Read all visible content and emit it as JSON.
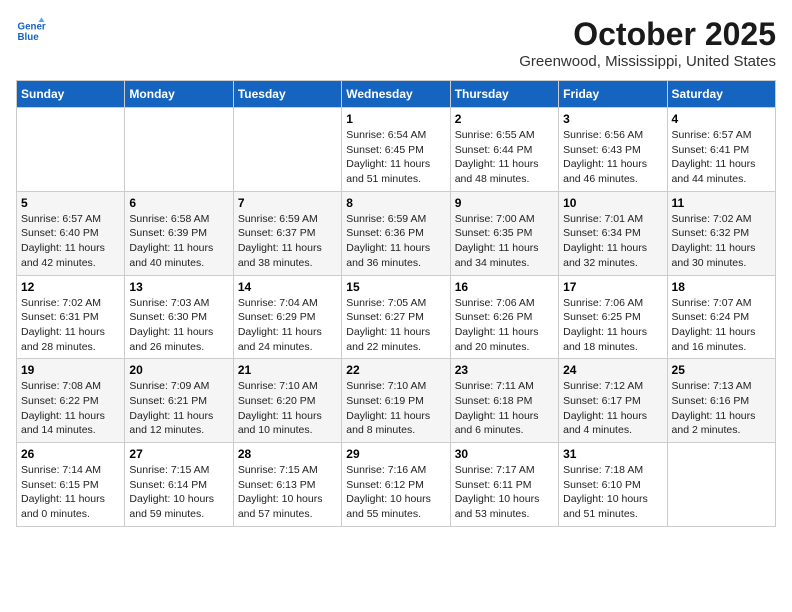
{
  "header": {
    "logo_line1": "General",
    "logo_line2": "Blue",
    "month": "October 2025",
    "location": "Greenwood, Mississippi, United States"
  },
  "days_of_week": [
    "Sunday",
    "Monday",
    "Tuesday",
    "Wednesday",
    "Thursday",
    "Friday",
    "Saturday"
  ],
  "weeks": [
    [
      {
        "day": "",
        "info": ""
      },
      {
        "day": "",
        "info": ""
      },
      {
        "day": "",
        "info": ""
      },
      {
        "day": "1",
        "info": "Sunrise: 6:54 AM\nSunset: 6:45 PM\nDaylight: 11 hours\nand 51 minutes."
      },
      {
        "day": "2",
        "info": "Sunrise: 6:55 AM\nSunset: 6:44 PM\nDaylight: 11 hours\nand 48 minutes."
      },
      {
        "day": "3",
        "info": "Sunrise: 6:56 AM\nSunset: 6:43 PM\nDaylight: 11 hours\nand 46 minutes."
      },
      {
        "day": "4",
        "info": "Sunrise: 6:57 AM\nSunset: 6:41 PM\nDaylight: 11 hours\nand 44 minutes."
      }
    ],
    [
      {
        "day": "5",
        "info": "Sunrise: 6:57 AM\nSunset: 6:40 PM\nDaylight: 11 hours\nand 42 minutes."
      },
      {
        "day": "6",
        "info": "Sunrise: 6:58 AM\nSunset: 6:39 PM\nDaylight: 11 hours\nand 40 minutes."
      },
      {
        "day": "7",
        "info": "Sunrise: 6:59 AM\nSunset: 6:37 PM\nDaylight: 11 hours\nand 38 minutes."
      },
      {
        "day": "8",
        "info": "Sunrise: 6:59 AM\nSunset: 6:36 PM\nDaylight: 11 hours\nand 36 minutes."
      },
      {
        "day": "9",
        "info": "Sunrise: 7:00 AM\nSunset: 6:35 PM\nDaylight: 11 hours\nand 34 minutes."
      },
      {
        "day": "10",
        "info": "Sunrise: 7:01 AM\nSunset: 6:34 PM\nDaylight: 11 hours\nand 32 minutes."
      },
      {
        "day": "11",
        "info": "Sunrise: 7:02 AM\nSunset: 6:32 PM\nDaylight: 11 hours\nand 30 minutes."
      }
    ],
    [
      {
        "day": "12",
        "info": "Sunrise: 7:02 AM\nSunset: 6:31 PM\nDaylight: 11 hours\nand 28 minutes."
      },
      {
        "day": "13",
        "info": "Sunrise: 7:03 AM\nSunset: 6:30 PM\nDaylight: 11 hours\nand 26 minutes."
      },
      {
        "day": "14",
        "info": "Sunrise: 7:04 AM\nSunset: 6:29 PM\nDaylight: 11 hours\nand 24 minutes."
      },
      {
        "day": "15",
        "info": "Sunrise: 7:05 AM\nSunset: 6:27 PM\nDaylight: 11 hours\nand 22 minutes."
      },
      {
        "day": "16",
        "info": "Sunrise: 7:06 AM\nSunset: 6:26 PM\nDaylight: 11 hours\nand 20 minutes."
      },
      {
        "day": "17",
        "info": "Sunrise: 7:06 AM\nSunset: 6:25 PM\nDaylight: 11 hours\nand 18 minutes."
      },
      {
        "day": "18",
        "info": "Sunrise: 7:07 AM\nSunset: 6:24 PM\nDaylight: 11 hours\nand 16 minutes."
      }
    ],
    [
      {
        "day": "19",
        "info": "Sunrise: 7:08 AM\nSunset: 6:22 PM\nDaylight: 11 hours\nand 14 minutes."
      },
      {
        "day": "20",
        "info": "Sunrise: 7:09 AM\nSunset: 6:21 PM\nDaylight: 11 hours\nand 12 minutes."
      },
      {
        "day": "21",
        "info": "Sunrise: 7:10 AM\nSunset: 6:20 PM\nDaylight: 11 hours\nand 10 minutes."
      },
      {
        "day": "22",
        "info": "Sunrise: 7:10 AM\nSunset: 6:19 PM\nDaylight: 11 hours\nand 8 minutes."
      },
      {
        "day": "23",
        "info": "Sunrise: 7:11 AM\nSunset: 6:18 PM\nDaylight: 11 hours\nand 6 minutes."
      },
      {
        "day": "24",
        "info": "Sunrise: 7:12 AM\nSunset: 6:17 PM\nDaylight: 11 hours\nand 4 minutes."
      },
      {
        "day": "25",
        "info": "Sunrise: 7:13 AM\nSunset: 6:16 PM\nDaylight: 11 hours\nand 2 minutes."
      }
    ],
    [
      {
        "day": "26",
        "info": "Sunrise: 7:14 AM\nSunset: 6:15 PM\nDaylight: 11 hours\nand 0 minutes."
      },
      {
        "day": "27",
        "info": "Sunrise: 7:15 AM\nSunset: 6:14 PM\nDaylight: 10 hours\nand 59 minutes."
      },
      {
        "day": "28",
        "info": "Sunrise: 7:15 AM\nSunset: 6:13 PM\nDaylight: 10 hours\nand 57 minutes."
      },
      {
        "day": "29",
        "info": "Sunrise: 7:16 AM\nSunset: 6:12 PM\nDaylight: 10 hours\nand 55 minutes."
      },
      {
        "day": "30",
        "info": "Sunrise: 7:17 AM\nSunset: 6:11 PM\nDaylight: 10 hours\nand 53 minutes."
      },
      {
        "day": "31",
        "info": "Sunrise: 7:18 AM\nSunset: 6:10 PM\nDaylight: 10 hours\nand 51 minutes."
      },
      {
        "day": "",
        "info": ""
      }
    ]
  ]
}
